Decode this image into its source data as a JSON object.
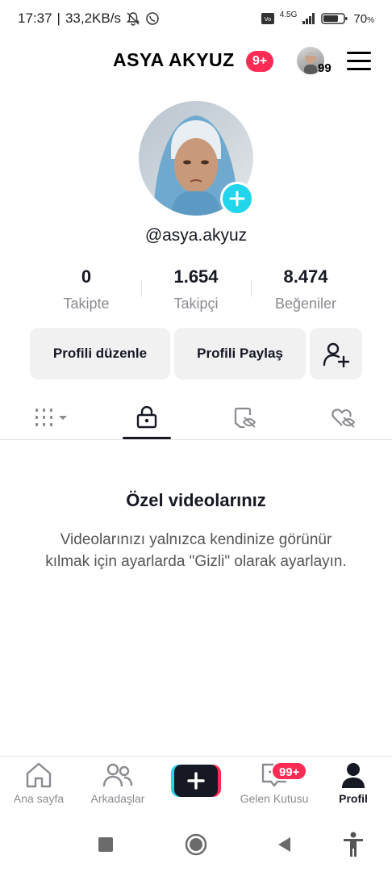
{
  "status_bar": {
    "time": "17:37",
    "speed": "33,2KB/s",
    "network": "4.5G",
    "battery": "70"
  },
  "header": {
    "title": "ASYA AKYUZ",
    "notification_badge": "9+",
    "avatar_count": "99",
    "menu_icon": "hamburger-menu-icon"
  },
  "profile": {
    "handle": "@asya.akyuz"
  },
  "stats": [
    {
      "value": "0",
      "label": "Takipte"
    },
    {
      "value": "1.654",
      "label": "Takipçi"
    },
    {
      "value": "8.474",
      "label": "Beğeniler"
    }
  ],
  "actions": {
    "edit_profile": "Profili düzenle",
    "share_profile": "Profili Paylaş",
    "add_friend_icon": "person-add-icon"
  },
  "tabs": [
    "grid-icon",
    "lock-icon",
    "tagged-icon",
    "liked-icon"
  ],
  "empty_state": {
    "title": "Özel videolarınız",
    "description": "Videolarınızı yalnızca kendinize görünür kılmak için ayarlarda \"Gizli\" olarak ayarlayın."
  },
  "bottom_nav": {
    "home": "Ana sayfa",
    "friends": "Arkadaşlar",
    "inbox": "Gelen Kutusu",
    "inbox_badge": "99+",
    "profile": "Profil"
  },
  "colors": {
    "accent_red": "#fe2c55",
    "accent_cyan": "#20d5ec",
    "text_primary": "#161823",
    "text_secondary": "#8a8b91"
  }
}
